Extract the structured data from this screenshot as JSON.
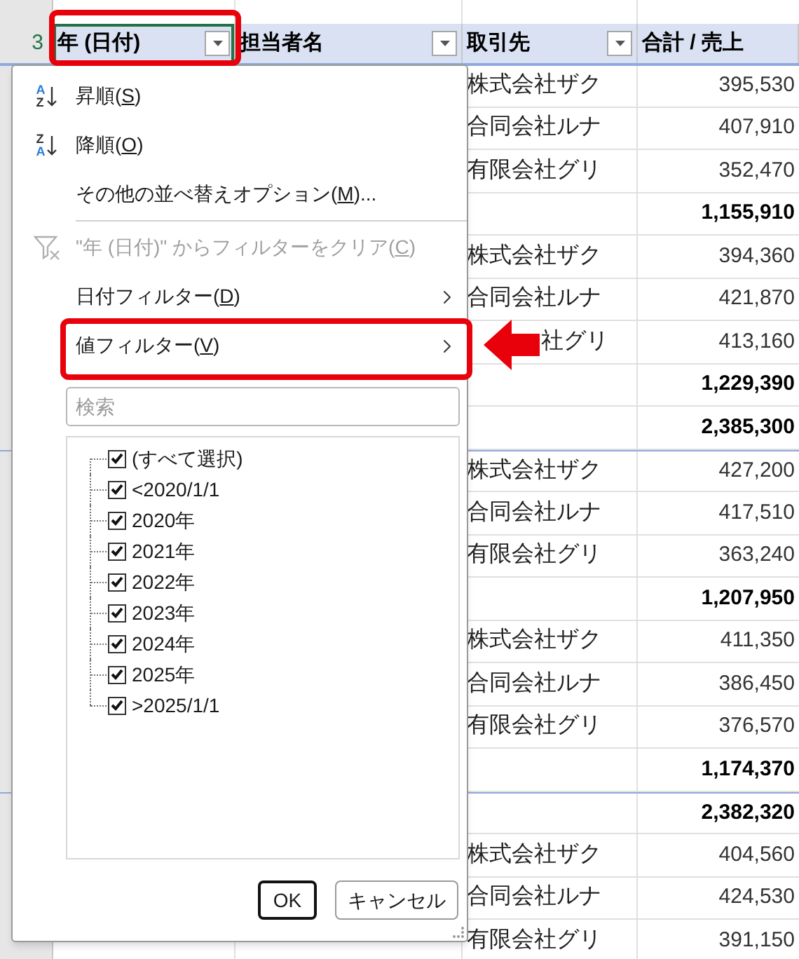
{
  "sheet": {
    "header_row_number": "3",
    "columns": [
      {
        "label": "年 (日付)",
        "filter_button": true,
        "selected": true,
        "highlighted": true
      },
      {
        "label": "担当者名",
        "filter_button": true,
        "selected": false,
        "highlighted": false
      },
      {
        "label": "取引先",
        "filter_button": true,
        "selected": false,
        "highlighted": false
      },
      {
        "label": "合計 / 売上",
        "filter_button": false,
        "selected": false,
        "highlighted": false
      }
    ],
    "rows": [
      {
        "kind": "detail",
        "partner": "株式会社ザク",
        "amount": "395,530",
        "group_start": true
      },
      {
        "kind": "detail",
        "partner": "合同会社ルナ",
        "amount": "407,910",
        "group_start": false
      },
      {
        "kind": "detail",
        "partner": "有限会社グリ",
        "amount": "352,470",
        "group_start": false
      },
      {
        "kind": "total",
        "amount": "1,155,910",
        "group_start": false
      },
      {
        "kind": "detail",
        "partner": "株式会社ザク",
        "amount": "394,360",
        "group_start": false
      },
      {
        "kind": "detail",
        "partner": "合同会社ルナ",
        "amount": "421,870",
        "group_start": false
      },
      {
        "kind": "detail",
        "partner": "社グリ",
        "amount": "413,160",
        "group_start": false,
        "covered": true
      },
      {
        "kind": "total",
        "amount": "1,229,390",
        "group_start": false
      },
      {
        "kind": "total",
        "amount": "2,385,300",
        "group_start": false
      },
      {
        "kind": "detail",
        "partner": "株式会社ザク",
        "amount": "427,200",
        "group_start": true
      },
      {
        "kind": "detail",
        "partner": "合同会社ルナ",
        "amount": "417,510",
        "group_start": false
      },
      {
        "kind": "detail",
        "partner": "有限会社グリ",
        "amount": "363,240",
        "group_start": false
      },
      {
        "kind": "total",
        "amount": "1,207,950",
        "group_start": false
      },
      {
        "kind": "detail",
        "partner": "株式会社ザク",
        "amount": "411,350",
        "group_start": false
      },
      {
        "kind": "detail",
        "partner": "合同会社ルナ",
        "amount": "386,450",
        "group_start": false
      },
      {
        "kind": "detail",
        "partner": "有限会社グリ",
        "amount": "376,570",
        "group_start": false
      },
      {
        "kind": "total",
        "amount": "1,174,370",
        "group_start": false
      },
      {
        "kind": "total",
        "amount": "2,382,320",
        "group_start": true
      },
      {
        "kind": "detail",
        "partner": "株式会社ザク",
        "amount": "404,560",
        "group_start": false
      },
      {
        "kind": "detail",
        "partner": "合同会社ルナ",
        "amount": "424,530",
        "group_start": false
      },
      {
        "kind": "detail",
        "partner": "有限会社グリ",
        "amount": "391,150",
        "group_start": false
      }
    ]
  },
  "filter_menu": {
    "items": [
      {
        "kind": "sort_asc",
        "icon_text": [
          "A",
          "Z"
        ],
        "label": [
          "昇順(",
          "S",
          ")"
        ],
        "disabled": false,
        "highlighted": false
      },
      {
        "kind": "sort_desc",
        "icon_text": [
          "Z",
          "A"
        ],
        "label": [
          "降順(",
          "O",
          ")"
        ],
        "disabled": false,
        "highlighted": false
      },
      {
        "kind": "command",
        "label": [
          "その他の並べ替えオプション(",
          "M",
          ")..."
        ],
        "disabled": false,
        "highlighted": false
      },
      {
        "kind": "separator"
      },
      {
        "kind": "clear_filter",
        "label": [
          "\"年 (日付)\" からフィルターをクリア(",
          "C",
          ")"
        ],
        "disabled": true,
        "highlighted": false
      },
      {
        "kind": "submenu",
        "label": [
          "日付フィルター(",
          "D",
          ")"
        ],
        "disabled": false,
        "highlighted": false
      },
      {
        "kind": "submenu",
        "label": [
          "値フィルター(",
          "V",
          ")"
        ],
        "disabled": false,
        "highlighted": true
      }
    ],
    "search": {
      "placeholder": "検索"
    },
    "values": [
      {
        "label": "(すべて選択)",
        "checked": true
      },
      {
        "label": "<2020/1/1",
        "checked": true
      },
      {
        "label": "2020年",
        "checked": true
      },
      {
        "label": "2021年",
        "checked": true
      },
      {
        "label": "2022年",
        "checked": true
      },
      {
        "label": "2023年",
        "checked": true
      },
      {
        "label": "2024年",
        "checked": true
      },
      {
        "label": "2025年",
        "checked": true
      },
      {
        "label": ">2025/1/1",
        "checked": true
      }
    ],
    "buttons": [
      {
        "label": "OK",
        "default": true
      },
      {
        "label": "キャンセル",
        "default": false
      }
    ]
  }
}
